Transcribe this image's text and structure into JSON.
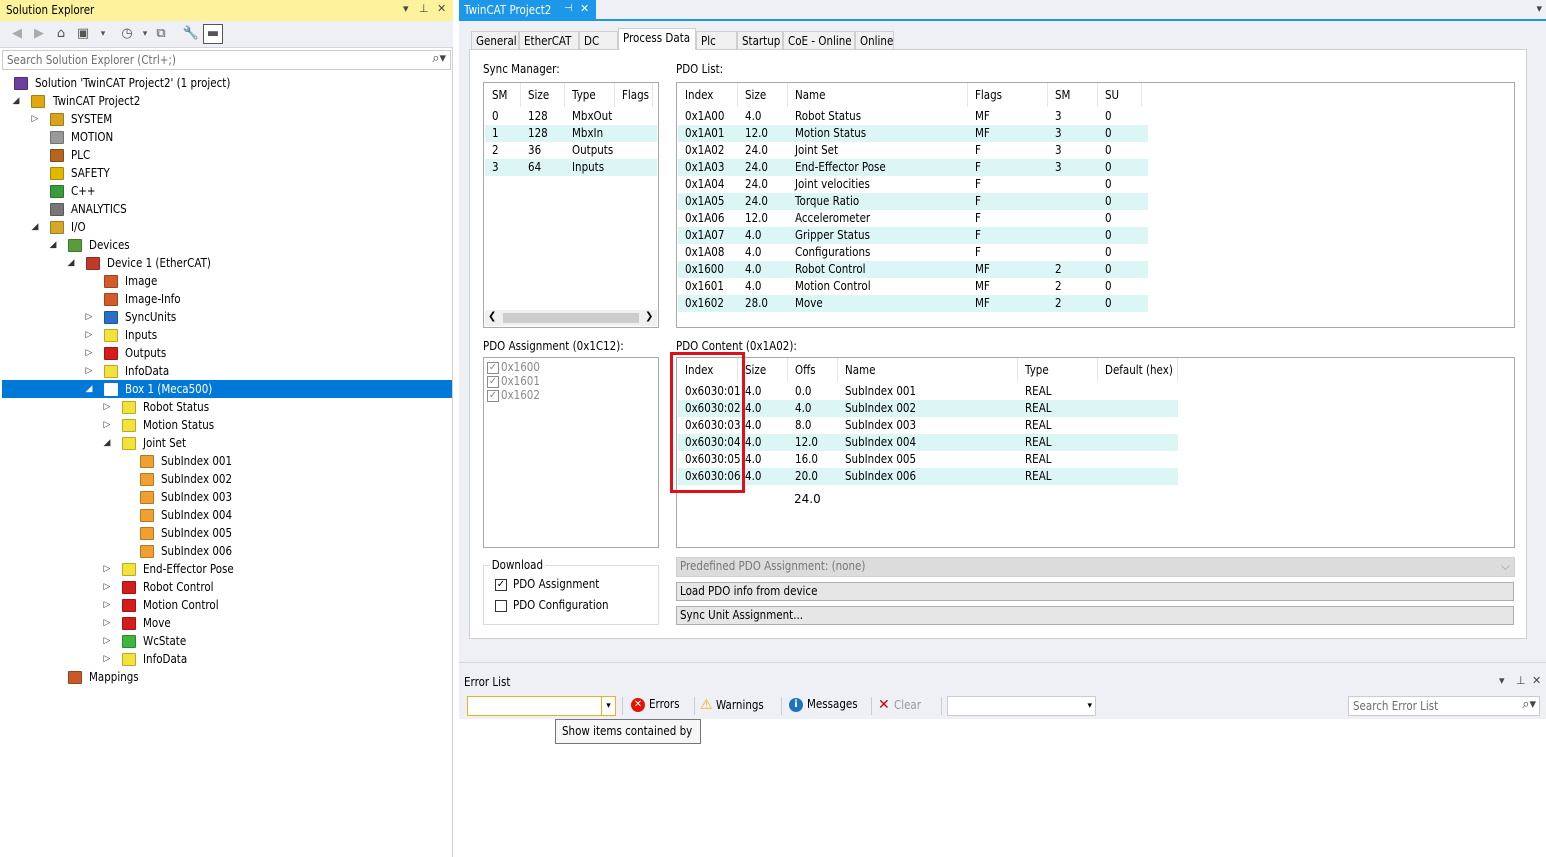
{
  "solution_explorer": {
    "title": "Solution Explorer",
    "pin_glyph": "▾ ⊓ ✕",
    "search_placeholder": "Search Solution Explorer (Ctrl+;)",
    "tree": [
      {
        "label": "Solution 'TwinCAT Project2' (1 project)",
        "icon": "solution-icon"
      },
      {
        "label": "TwinCAT Project2",
        "icon": "project-icon"
      },
      {
        "label": "SYSTEM",
        "icon": "system-icon"
      },
      {
        "label": "MOTION",
        "icon": "motion-icon"
      },
      {
        "label": "PLC",
        "icon": "plc-icon"
      },
      {
        "label": "SAFETY",
        "icon": "safety-icon"
      },
      {
        "label": "C++",
        "icon": "cpp-icon"
      },
      {
        "label": "ANALYTICS",
        "icon": "analytics-icon"
      },
      {
        "label": "I/O",
        "icon": "io-icon"
      },
      {
        "label": "Devices",
        "icon": "devices-icon"
      },
      {
        "label": "Device 1 (EtherCAT)",
        "icon": "ethercat-device-icon"
      },
      {
        "label": "Image",
        "icon": "image-icon"
      },
      {
        "label": "Image-Info",
        "icon": "image-info-icon"
      },
      {
        "label": "SyncUnits",
        "icon": "sync-units-icon"
      },
      {
        "label": "Inputs",
        "icon": "inputs-folder-icon"
      },
      {
        "label": "Outputs",
        "icon": "outputs-folder-icon"
      },
      {
        "label": "InfoData",
        "icon": "infodata-folder-icon"
      },
      {
        "label": "Box 1 (Meca500)",
        "icon": "box-icon"
      },
      {
        "label": "Robot Status",
        "icon": "input-folder-icon"
      },
      {
        "label": "Motion Status",
        "icon": "input-folder-icon"
      },
      {
        "label": "Joint Set",
        "icon": "input-folder-icon"
      },
      {
        "label": "SubIndex 001",
        "icon": "variable-icon"
      },
      {
        "label": "SubIndex 002",
        "icon": "variable-icon"
      },
      {
        "label": "SubIndex 003",
        "icon": "variable-icon"
      },
      {
        "label": "SubIndex 004",
        "icon": "variable-icon"
      },
      {
        "label": "SubIndex 005",
        "icon": "variable-icon"
      },
      {
        "label": "SubIndex 006",
        "icon": "variable-icon"
      },
      {
        "label": "End-Effector Pose",
        "icon": "input-folder-icon"
      },
      {
        "label": "Robot Control",
        "icon": "output-folder-icon"
      },
      {
        "label": "Motion Control",
        "icon": "output-folder-icon"
      },
      {
        "label": "Move",
        "icon": "output-folder-icon"
      },
      {
        "label": "WcState",
        "icon": "wcstate-folder-icon"
      },
      {
        "label": "InfoData",
        "icon": "infodata-folder-icon"
      },
      {
        "label": "Mappings",
        "icon": "mappings-icon"
      }
    ]
  },
  "editor": {
    "doc_tab": "TwinCAT Project2",
    "tabs": [
      "General",
      "EtherCAT",
      "DC",
      "Process Data",
      "Plc",
      "Startup",
      "CoE - Online",
      "Online"
    ],
    "active_tab": "Process Data",
    "sync_manager": {
      "label": "Sync Manager:",
      "headers": [
        "SM",
        "Size",
        "Type",
        "Flags"
      ],
      "rows": [
        [
          "0",
          "128",
          "MbxOut",
          ""
        ],
        [
          "1",
          "128",
          "MbxIn",
          ""
        ],
        [
          "2",
          "36",
          "Outputs",
          ""
        ],
        [
          "3",
          "64",
          "Inputs",
          ""
        ]
      ]
    },
    "pdo_list": {
      "label": "PDO List:",
      "headers": [
        "Index",
        "Size",
        "Name",
        "Flags",
        "SM",
        "SU"
      ],
      "rows": [
        [
          "0x1A00",
          "4.0",
          "Robot Status",
          "MF",
          "3",
          "0"
        ],
        [
          "0x1A01",
          "12.0",
          "Motion Status",
          "MF",
          "3",
          "0"
        ],
        [
          "0x1A02",
          "24.0",
          "Joint Set",
          "F",
          "3",
          "0"
        ],
        [
          "0x1A03",
          "24.0",
          "End-Effector Pose",
          "F",
          "3",
          "0"
        ],
        [
          "0x1A04",
          "24.0",
          "Joint velocities",
          "F",
          "",
          "0"
        ],
        [
          "0x1A05",
          "24.0",
          "Torque Ratio",
          "F",
          "",
          "0"
        ],
        [
          "0x1A06",
          "12.0",
          "Accelerometer",
          "F",
          "",
          "0"
        ],
        [
          "0x1A07",
          "4.0",
          "Gripper Status",
          "F",
          "",
          "0"
        ],
        [
          "0x1A08",
          "4.0",
          "Configurations",
          "F",
          "",
          "0"
        ],
        [
          "0x1600",
          "4.0",
          "Robot Control",
          "MF",
          "2",
          "0"
        ],
        [
          "0x1601",
          "4.0",
          "Motion Control",
          "MF",
          "2",
          "0"
        ],
        [
          "0x1602",
          "28.0",
          "Move",
          "MF",
          "2",
          "0"
        ]
      ]
    },
    "pdo_assignment": {
      "label": "PDO Assignment (0x1C12):",
      "items": [
        "0x1600",
        "0x1601",
        "0x1602"
      ]
    },
    "pdo_content": {
      "label": "PDO Content (0x1A02):",
      "headers": [
        "Index",
        "Size",
        "Offs",
        "Name",
        "Type",
        "Default (hex)"
      ],
      "rows": [
        [
          "0x6030:01",
          "4.0",
          "0.0",
          "SubIndex 001",
          "REAL",
          ""
        ],
        [
          "0x6030:02",
          "4.0",
          "4.0",
          "SubIndex 002",
          "REAL",
          ""
        ],
        [
          "0x6030:03",
          "4.0",
          "8.0",
          "SubIndex 003",
          "REAL",
          ""
        ],
        [
          "0x6030:04",
          "4.0",
          "12.0",
          "SubIndex 004",
          "REAL",
          ""
        ],
        [
          "0x6030:05",
          "4.0",
          "16.0",
          "SubIndex 005",
          "REAL",
          ""
        ],
        [
          "0x6030:06",
          "4.0",
          "20.0",
          "SubIndex 006",
          "REAL",
          ""
        ]
      ],
      "total_offset": "24.0"
    },
    "download": {
      "label": "Download",
      "pdo_assignment": "PDO Assignment",
      "pdo_configuration": "PDO Configuration"
    },
    "predefined": "Predefined PDO Assignment: (none)",
    "load_button": "Load PDO info from device",
    "sync_unit_button": "Sync Unit Assignment...",
    "highlight_color": "#e0101a"
  },
  "error_list": {
    "title": "Error List",
    "errors": "Errors",
    "warnings": "Warnings",
    "messages": "Messages",
    "clear": "Clear",
    "search_placeholder": "Search Error List",
    "tooltip": "Show items contained by"
  }
}
